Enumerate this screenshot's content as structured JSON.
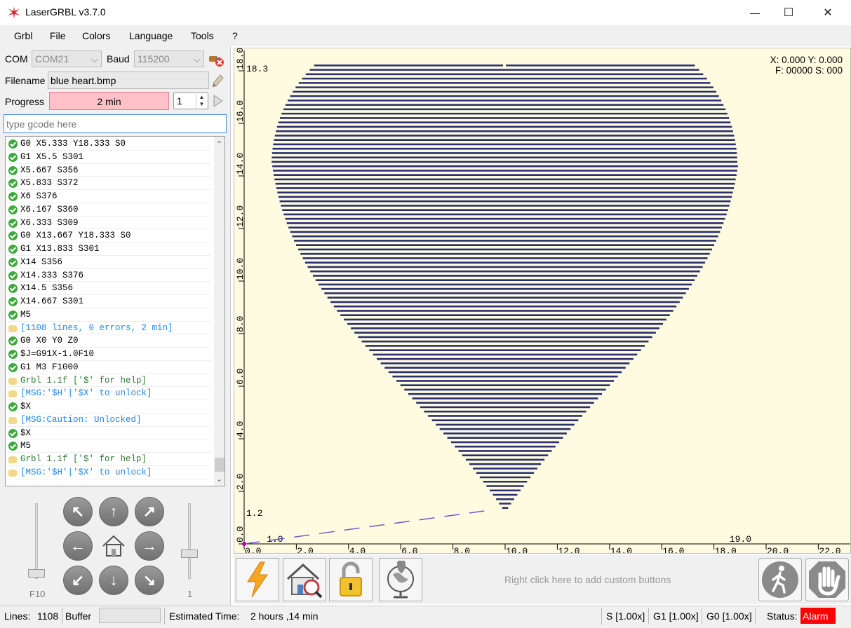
{
  "window": {
    "title": "LaserGRBL v3.7.0",
    "minimize_glyph": "—",
    "maximize_glyph": "☐",
    "close_glyph": "✕"
  },
  "menu": [
    "Grbl",
    "File",
    "Colors",
    "Language",
    "Tools",
    "?"
  ],
  "conn": {
    "com_label": "COM",
    "com_value": "COM21",
    "baud_label": "Baud",
    "baud_value": "115200",
    "filename_label": "Filename",
    "filename_value": "blue heart.bmp",
    "progress_label": "Progress",
    "progress_value": "2 min",
    "passes": "1"
  },
  "gcode_placeholder": "type gcode here",
  "log": [
    {
      "t": "G0 X5.333 Y18.333 S0",
      "k": "ok"
    },
    {
      "t": "G1 X5.5 S301",
      "k": "ok"
    },
    {
      "t": "X5.667 S356",
      "k": "ok"
    },
    {
      "t": "X5.833 S372",
      "k": "ok"
    },
    {
      "t": "X6 S376",
      "k": "ok"
    },
    {
      "t": "X6.167 S360",
      "k": "ok"
    },
    {
      "t": "X6.333 S309",
      "k": "ok"
    },
    {
      "t": "G0 X13.667 Y18.333 S0",
      "k": "ok"
    },
    {
      "t": "G1 X13.833 S301",
      "k": "ok"
    },
    {
      "t": "X14 S356",
      "k": "ok"
    },
    {
      "t": "X14.333 S376",
      "k": "ok"
    },
    {
      "t": "X14.5 S356",
      "k": "ok"
    },
    {
      "t": "X14.667 S301",
      "k": "ok"
    },
    {
      "t": "M5",
      "k": "ok"
    },
    {
      "t": "[1108 lines, 0 errors, 2 min]",
      "k": "info"
    },
    {
      "t": "G0 X0 Y0 Z0",
      "k": "ok"
    },
    {
      "t": "$J=G91X-1.0F10",
      "k": "ok"
    },
    {
      "t": "G1 M3 F1000",
      "k": "ok"
    },
    {
      "t": "Grbl 1.1f ['$' for help]",
      "k": "grbl"
    },
    {
      "t": "[MSG:'$H'|'$X' to unlock]",
      "k": "info"
    },
    {
      "t": "$X",
      "k": "ok"
    },
    {
      "t": "[MSG:Caution: Unlocked]",
      "k": "info"
    },
    {
      "t": "$X",
      "k": "ok"
    },
    {
      "t": "M5",
      "k": "ok"
    },
    {
      "t": "Grbl 1.1f ['$' for help]",
      "k": "grbl"
    },
    {
      "t": "[MSG:'$H'|'$X' to unlock]",
      "k": "info"
    }
  ],
  "jog": {
    "speed_label": "F10",
    "step_label": "1",
    "arrows": [
      "↖",
      "↑",
      "↗",
      "←",
      "⌂",
      "→",
      "↙",
      "↓",
      "↘"
    ]
  },
  "preview": {
    "coords_line1": "X: 0.000 Y: 0.000",
    "coords_line2": "F: 00000 S: 000",
    "x_ticks": [
      "0.0",
      "2.0",
      "4.0",
      "6.0",
      "8.0",
      "10.0",
      "12.0",
      "14.0",
      "16.0",
      "18.0",
      "20.0",
      "22.0"
    ],
    "y_ticks": [
      "0.0",
      "2.0",
      "4.0",
      "6.0",
      "8.0",
      "10.0",
      "12.0",
      "14.0",
      "16.0",
      "18.0"
    ],
    "bounds": {
      "xmin": "1.0",
      "xmax": "19.0",
      "ymin": "1.2",
      "ymax": "18.3"
    },
    "fill_color": "#2a2f6e"
  },
  "toolbar": {
    "custom_hint": "Right click here to add custom buttons",
    "icons": [
      "lightning-icon",
      "home-icon",
      "unlock-icon",
      "globe-icon",
      "walk-icon",
      "stop-hand-icon"
    ]
  },
  "status": {
    "lines_label": "Lines:",
    "lines_value": "1108",
    "buffer_label": "Buffer",
    "est_label": "Estimated Time:",
    "est_value": "2 hours ,14 min",
    "s_override": "S [1.00x]",
    "g1_override": "G1 [1.00x]",
    "g0_override": "G0 [1.00x]",
    "status_label": "Status:",
    "status_value": "Alarm",
    "alarm_color": "#ff0000"
  }
}
